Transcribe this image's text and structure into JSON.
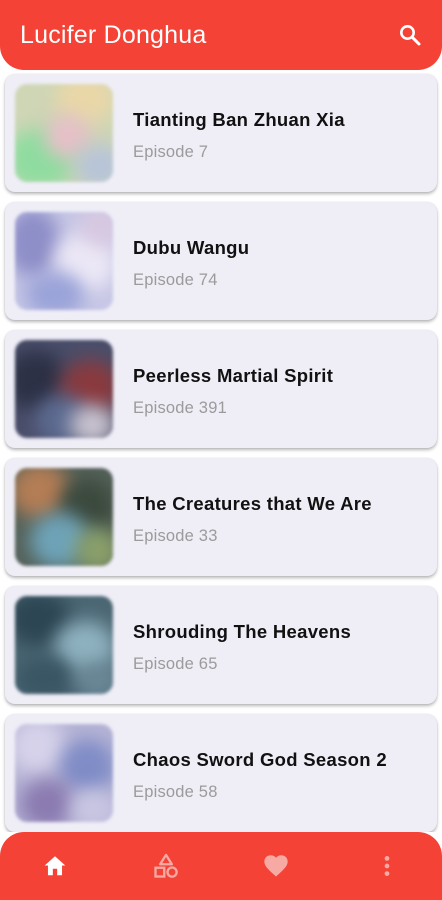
{
  "app": {
    "title": "Lucifer Donghua"
  },
  "list": [
    {
      "title": "Tianting Ban Zhuan Xia",
      "subtitle": "Episode 7"
    },
    {
      "title": "Dubu Wangu",
      "subtitle": "Episode 74"
    },
    {
      "title": "Peerless Martial Spirit",
      "subtitle": "Episode 391"
    },
    {
      "title": "The Creatures that We Are",
      "subtitle": "Episode 33"
    },
    {
      "title": "Shrouding The Heavens",
      "subtitle": "Episode 65"
    },
    {
      "title": "Chaos Sword God Season 2",
      "subtitle": "Episode 58"
    }
  ],
  "bottom_nav": {
    "items": [
      {
        "icon": "home-icon",
        "active": true
      },
      {
        "icon": "categories-icon",
        "active": false
      },
      {
        "icon": "heart-icon",
        "active": false
      },
      {
        "icon": "more-vertical-icon",
        "active": false
      }
    ]
  },
  "colors": {
    "primary": "#f44336",
    "card": "#efeef7",
    "indicator": "#7e57c2",
    "icon_active": "#ffffff",
    "icon_inactive": "#f6aaa3"
  }
}
